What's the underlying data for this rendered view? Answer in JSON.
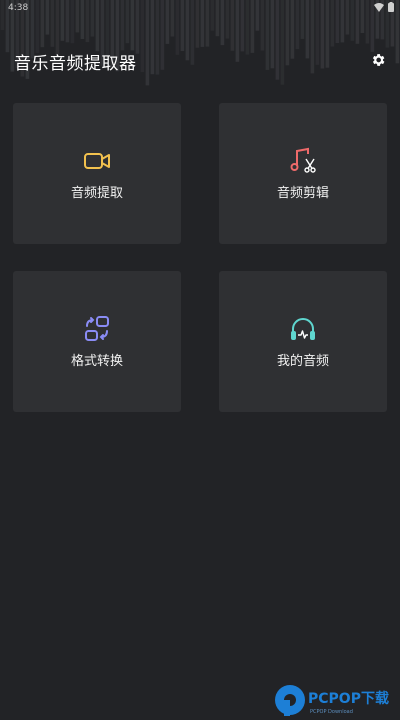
{
  "status_bar": {
    "time": "4:38"
  },
  "header": {
    "title": "音乐音频提取器",
    "settings_icon": "gear-icon"
  },
  "features": [
    {
      "label": "音频提取",
      "icon": "video-camera-icon",
      "color": "#f2c14e"
    },
    {
      "label": "音频剪辑",
      "icon": "music-scissors-icon",
      "color": "#ef6a6a"
    },
    {
      "label": "格式转换",
      "icon": "format-convert-icon",
      "color": "#8a8cf5"
    },
    {
      "label": "我的音频",
      "icon": "headphones-icon",
      "color": "#5fd6cf"
    }
  ],
  "watermark": {
    "brand": "PCPOP下载",
    "sub": "PCPOP Download"
  },
  "colors": {
    "background": "#222326",
    "card": "#2f3033"
  }
}
